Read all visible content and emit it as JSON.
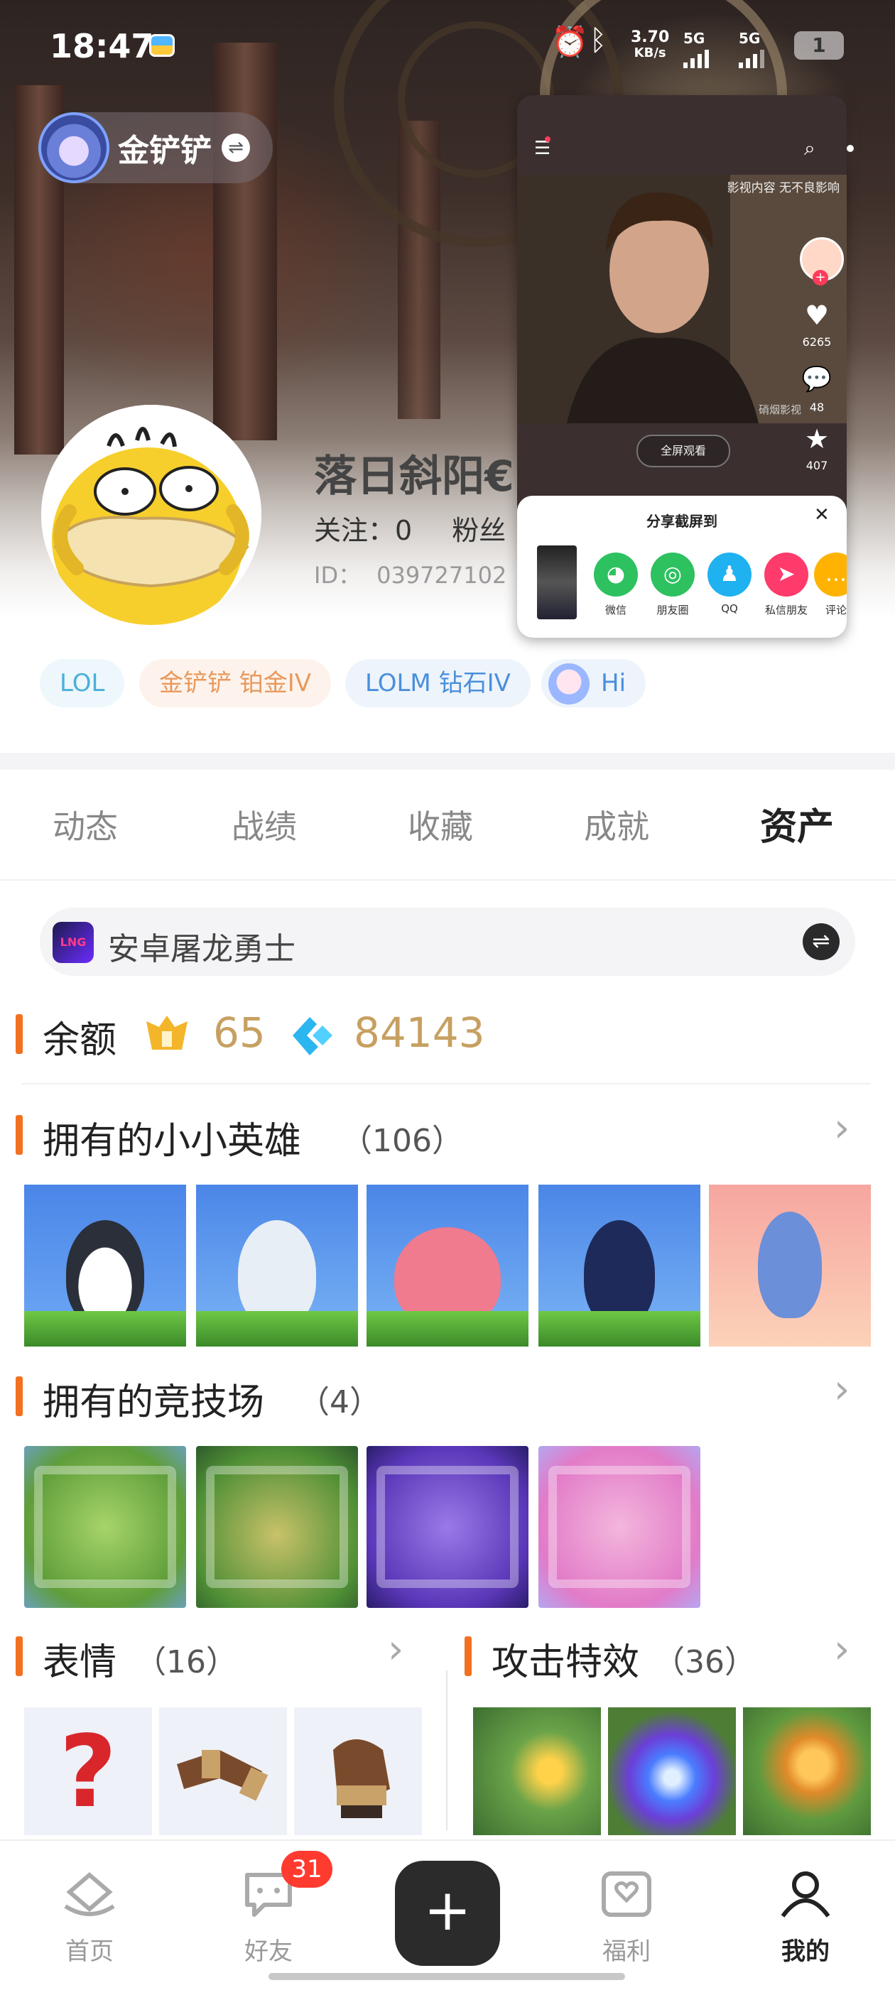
{
  "status_bar": {
    "time": "18:47",
    "net_speed_value": "3.70",
    "net_speed_unit": "KB/s",
    "sim1_label": "5G",
    "sim2_label": "5G",
    "battery": "1"
  },
  "account": {
    "name": "金铲铲"
  },
  "profile": {
    "nickname": "落日斜阳€",
    "follow_label": "关注：",
    "follow_count": "0",
    "fans_label": "粉丝",
    "id_label": "ID：",
    "id_value": "039727102"
  },
  "tags": [
    "LOL",
    "金铲铲 铂金IV",
    "LOLM 钻石IV",
    "Hi"
  ],
  "video_panel": {
    "watermark": "影视内容 无不良影响",
    "corner_label": "硝烟影视",
    "likes": "6265",
    "comments": "48",
    "favorites": "407",
    "fullscreen_label": "全屏观看",
    "share_title": "分享截屏到",
    "share_options": [
      "微信",
      "朋友圈",
      "QQ",
      "私信朋友",
      "评论"
    ]
  },
  "tabs": [
    "动态",
    "战绩",
    "收藏",
    "成就",
    "资产"
  ],
  "active_tab": "资产",
  "server": {
    "logo_text": "LNG",
    "name": "安卓屠龙勇士"
  },
  "balance": {
    "title": "余额",
    "gold": "65",
    "gems": "84143"
  },
  "sections": {
    "heroes": {
      "title": "拥有的小小英雄",
      "count": "（106）"
    },
    "arenas": {
      "title": "拥有的竞技场",
      "count": "（4）"
    },
    "emotes": {
      "title": "表情",
      "count": "（16）"
    },
    "effects": {
      "title": "攻击特效",
      "count": "（36）"
    }
  },
  "emote_glyphs": [
    "?",
    "",
    ""
  ],
  "bottom_nav": {
    "items": [
      "首页",
      "好友",
      "福利",
      "我的"
    ],
    "active": "我的",
    "friends_badge": "31"
  },
  "colors": {
    "accent": "#f37021",
    "gold_text": "#c7a061",
    "badge": "#ff3b30"
  },
  "icons": [
    "switch-icon",
    "menu-icon",
    "search-icon",
    "heart-icon",
    "comment-icon",
    "star-icon",
    "close-icon",
    "chevron-right-icon",
    "plus-icon",
    "home-icon",
    "chat-icon",
    "gift-icon",
    "person-icon"
  ]
}
